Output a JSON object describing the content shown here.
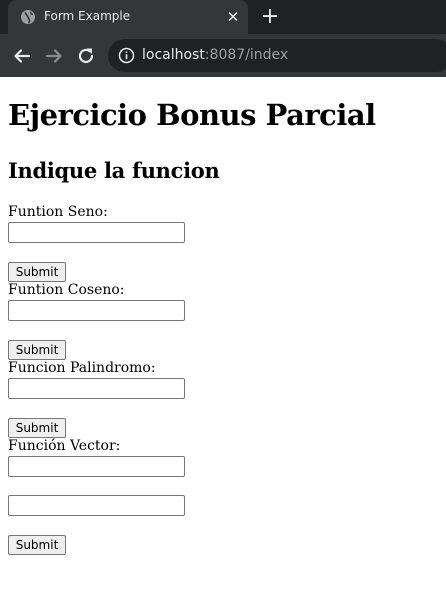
{
  "browser": {
    "tab_title": "Form Example",
    "tab_close": "✕",
    "new_tab": "+",
    "url_host": "localhost",
    "url_rest": ":8087/index"
  },
  "page": {
    "title": "Ejercicio Bonus Parcial",
    "subtitle": "Indique la funcion",
    "forms": [
      {
        "label": "Funtion Seno:",
        "value": "",
        "submit": "Submit"
      },
      {
        "label": "Funtion Coseno:",
        "value": "",
        "submit": "Submit"
      },
      {
        "label": "Funcion Palindromo:",
        "value": "",
        "submit": "Submit"
      },
      {
        "label": "Función Vector:",
        "value": "",
        "value2": "",
        "submit": "Submit"
      }
    ]
  },
  "colors": {
    "chrome_dark": "#202124",
    "chrome_tab": "#35363a",
    "chrome_text": "#e8eaed",
    "url_dim": "#9aa0a6"
  },
  "icons": {
    "favicon": "globe-icon",
    "back": "back-arrow-icon",
    "forward": "forward-arrow-icon",
    "reload": "reload-icon",
    "site_info": "info-icon"
  }
}
